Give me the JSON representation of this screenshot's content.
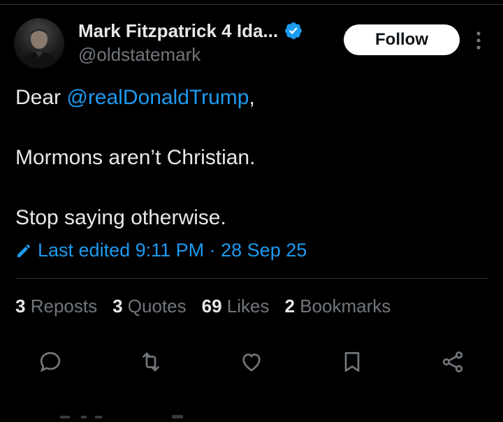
{
  "colors": {
    "background": "#000000",
    "accent": "#1d9bf0",
    "text": "#e7e9ea",
    "muted": "#71767b",
    "divider": "#2f3336"
  },
  "author": {
    "name": "Mark Fitzpatrick 4 Ida...",
    "handle": "@oldstatemark",
    "verified_icon": "verified-badge-icon",
    "avatar_icon": "profile-photo"
  },
  "follow_label": "Follow",
  "more_icon": "more-vertical-icon",
  "tweet": {
    "greeting": "Dear ",
    "mention": "@realDonaldTrump",
    "greeting_end": ",",
    "line2": "Mormons aren’t Christian.",
    "line3": "Stop saying otherwise."
  },
  "edited": {
    "icon": "pencil-icon",
    "label": "Last edited 9:11 PM · 28 Sep 25"
  },
  "stats": [
    {
      "count": "3",
      "label": "Reposts"
    },
    {
      "count": "3",
      "label": "Quotes"
    },
    {
      "count": "69",
      "label": "Likes"
    },
    {
      "count": "2",
      "label": "Bookmarks"
    }
  ],
  "actions": [
    "reply-icon",
    "repost-icon",
    "like-icon",
    "bookmark-icon",
    "share-icon"
  ]
}
